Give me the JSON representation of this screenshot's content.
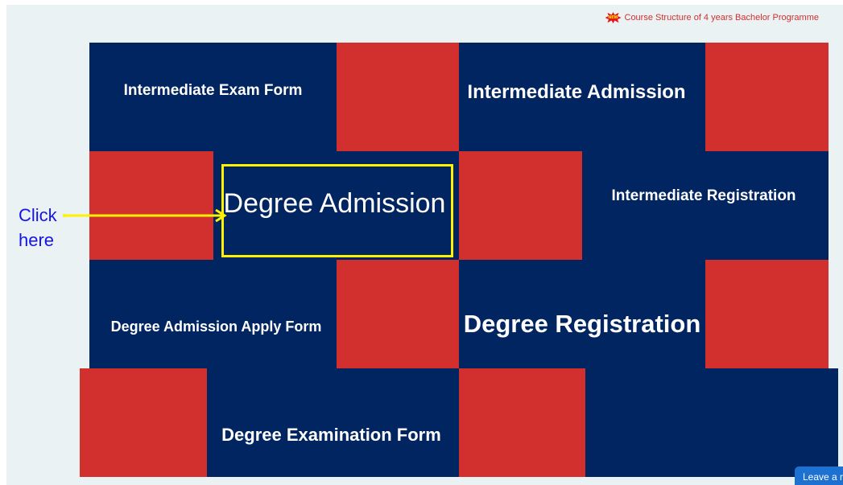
{
  "ticker": {
    "badge": "NEW",
    "text": "Course Structure of 4 years Bachelor Programme"
  },
  "tiles": {
    "intermediate_exam_form": "Intermediate Exam Form",
    "intermediate_admission": "Intermediate Admission",
    "degree_admission": "Degree Admission",
    "intermediate_registration": "Intermediate Registration",
    "degree_admission_apply_form": "Degree Admission Apply Form",
    "degree_registration": "Degree Registration",
    "degree_examination_form": "Degree Examination Form"
  },
  "annotation": {
    "line1": "Click",
    "line2": "here"
  },
  "chat": {
    "label": "Leave a message"
  },
  "colors": {
    "navy": "#002561",
    "red": "#d2302f",
    "highlight": "#fef200",
    "annotation": "#1414e6"
  }
}
